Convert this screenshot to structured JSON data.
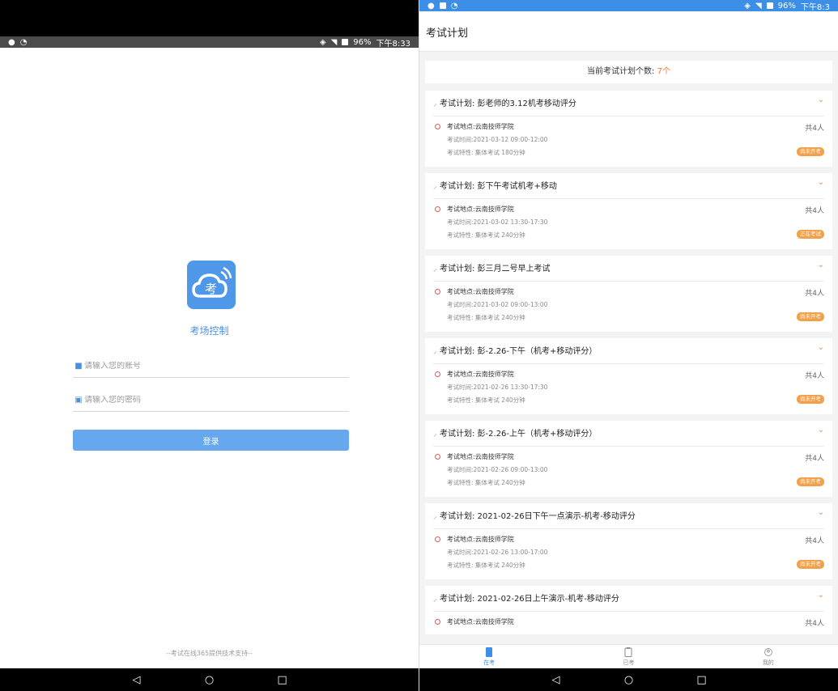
{
  "left": {
    "status": {
      "time": "下午8:33",
      "battery": "96%"
    },
    "app_name": "考场控制",
    "logo_text": "考",
    "account_placeholder": "请输入您的账号",
    "password_placeholder": "请输入您的密码",
    "login_label": "登录",
    "footer": "--考试在线365提供技术支持--",
    "nav": {
      "back": "◁",
      "home": "○",
      "recent": "□"
    }
  },
  "right": {
    "status": {
      "time": "下午8:3",
      "battery": "96%"
    },
    "title": "考试计划",
    "count_label": "当前考试计划个数:",
    "count_value": "7个",
    "plans": [
      {
        "title": "考试计划: 彭老师的3.12机考移动评分",
        "location": "考试地点:云南技师学院",
        "people": "共4人",
        "time": "考试时间:2021-03-12 09:00-12:00",
        "feature": "考试特性: 集体考试   180分钟",
        "status": "尚未开考"
      },
      {
        "title": "考试计划: 彭下午考试机考+移动",
        "location": "考试地点:云南技师学院",
        "people": "共4人",
        "time": "考试时间:2021-03-02 13:30-17:30",
        "feature": "考试特性: 集体考试   240分钟",
        "status": "正在考试"
      },
      {
        "title": "考试计划: 彭三月二号早上考试",
        "location": "考试地点:云南技师学院",
        "people": "共4人",
        "time": "考试时间:2021-03-02 09:00-13:00",
        "feature": "考试特性: 集体考试   240分钟",
        "status": "尚未开考"
      },
      {
        "title": "考试计划: 彭-2.26-下午（机考+移动评分）",
        "location": "考试地点:云南技师学院",
        "people": "共4人",
        "time": "考试时间:2021-02-26 13:30-17:30",
        "feature": "考试特性: 集体考试   240分钟",
        "status": "尚未开考"
      },
      {
        "title": "考试计划: 彭-2.26-上午（机考+移动评分）",
        "location": "考试地点:云南技师学院",
        "people": "共4人",
        "time": "考试时间:2021-02-26 09:00-13:00",
        "feature": "考试特性: 集体考试   240分钟",
        "status": "尚未开考"
      },
      {
        "title": "考试计划: 2021-02-26日下午一点演示-机考-移动评分",
        "location": "考试地点:云南技师学院",
        "people": "共4人",
        "time": "考试时间:2021-02-26 13:00-17:00",
        "feature": "考试特性: 集体考试   240分钟",
        "status": "尚未开考"
      },
      {
        "title": "考试计划: 2021-02-26日上午演示-机考-移动评分",
        "location": "考试地点:云南技师学院",
        "people": "共4人"
      }
    ],
    "tabs": [
      {
        "label": "在考"
      },
      {
        "label": "已考"
      },
      {
        "label": "我的"
      }
    ],
    "nav": {
      "back": "◁",
      "home": "○",
      "recent": "□"
    }
  },
  "colors": {
    "accent": "#3d8ee6",
    "badge": "#f3a04a",
    "count": "#ef7a2f"
  }
}
